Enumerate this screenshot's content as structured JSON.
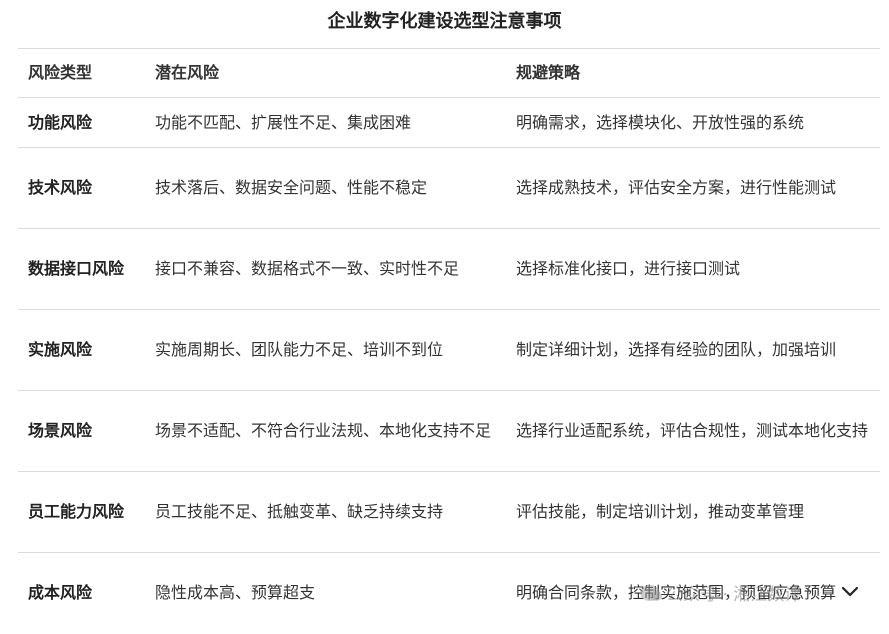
{
  "title": "企业数字化建设选型注意事项",
  "table": {
    "headers": [
      "风险类型",
      "潜在风险",
      "规避策略"
    ],
    "rows": [
      {
        "type": "功能风险",
        "risk": "功能不匹配、扩展性不足、集成困难",
        "strategy": "明确需求，选择模块化、开放性强的系统"
      },
      {
        "type": "技术风险",
        "risk": "技术落后、数据安全问题、性能不稳定",
        "strategy": "选择成熟技术，评估安全方案，进行性能测试"
      },
      {
        "type": "数据接口风险",
        "risk": "接口不兼容、数据格式不一致、实时性不足",
        "strategy": "选择标准化接口，进行接口测试"
      },
      {
        "type": "实施风险",
        "risk": "实施周期长、团队能力不足、培训不到位",
        "strategy": "制定详细计划，选择有经验的团队，加强培训"
      },
      {
        "type": "场景风险",
        "risk": "场景不适配、不符合行业法规、本地化支持不足",
        "strategy": "选择行业适配系统，评估合规性，测试本地化支持"
      },
      {
        "type": "员工能力风险",
        "risk": "员工技能不足、抵触变革、缺乏持续支持",
        "strategy": "评估技能，制定培训计划，推动变革管理"
      },
      {
        "type": "成本风险",
        "risk": "隐性成本高、预算超支",
        "strategy": "明确合同条款，控制实施范围，预留应急预算"
      }
    ]
  },
  "watermark": {
    "text": "公众号 · 湘江数评",
    "icon": "wechat-icon"
  },
  "controls": {
    "scroll_icon": "chevron-down-icon"
  }
}
